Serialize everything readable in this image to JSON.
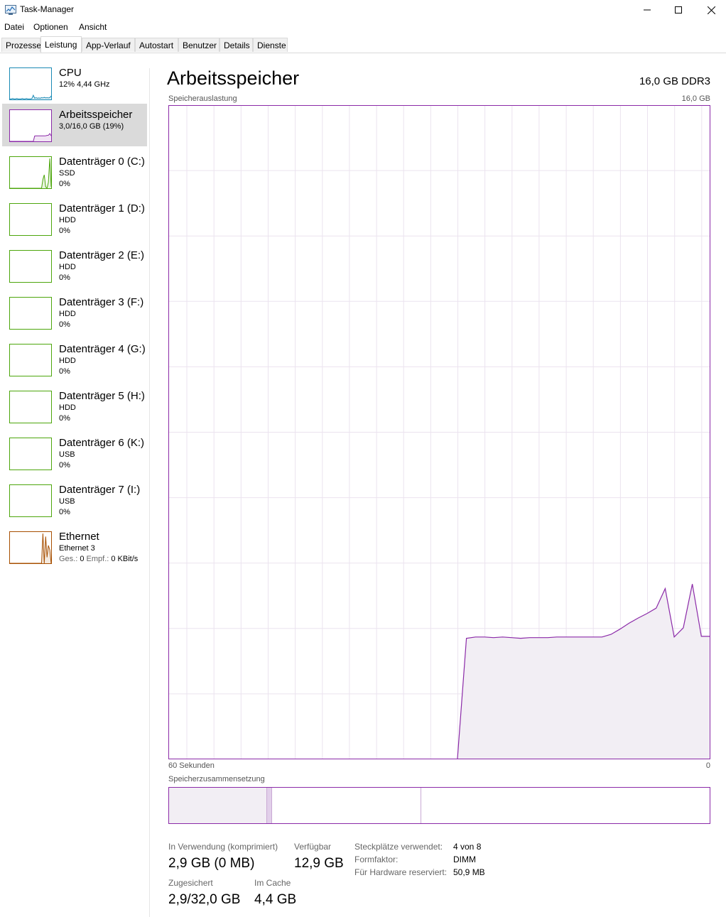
{
  "window": {
    "title": "Task-Manager",
    "icon": "task-manager-icon"
  },
  "menu": [
    "Datei",
    "Optionen",
    "Ansicht"
  ],
  "tabs": [
    "Prozesse",
    "Leistung",
    "App-Verlauf",
    "Autostart",
    "Benutzer",
    "Details",
    "Dienste"
  ],
  "active_tab": "Leistung",
  "sidebar": [
    {
      "title": "CPU",
      "line2": "12%  4,44 GHz",
      "line3": "",
      "color": "#1a8ab5",
      "values": [
        2,
        2,
        3,
        2,
        2,
        3,
        2,
        2,
        2,
        3,
        2,
        2,
        3,
        2,
        2,
        2,
        3,
        14,
        4,
        6,
        4,
        5,
        4,
        6,
        5,
        7,
        5,
        6,
        5,
        6,
        12
      ]
    },
    {
      "title": "Arbeitsspeicher",
      "line2": "3,0/16,0 GB (19%)",
      "line3": "",
      "color": "#8b2aa8",
      "selected": true,
      "values": [
        0,
        0,
        0,
        0,
        0,
        0,
        0,
        0,
        0,
        0,
        0,
        0,
        0,
        0,
        0,
        0,
        0,
        0,
        18,
        18.6,
        18.6,
        18.5,
        18.6,
        18.6,
        18.6,
        18.6,
        19,
        20,
        20.5,
        26,
        18.8
      ]
    },
    {
      "title": "Datenträger 0 (C:)",
      "line2": "SSD",
      "line3": "0%",
      "color": "#4da60c",
      "values": [
        0,
        0,
        0,
        0,
        0,
        0,
        0,
        0,
        0,
        0,
        0,
        0,
        0,
        0,
        0,
        0,
        0,
        0,
        0,
        0,
        0,
        0,
        0,
        0,
        30,
        45,
        5,
        0,
        20,
        100,
        5
      ]
    },
    {
      "title": "Datenträger 1 (D:)",
      "line2": "HDD",
      "line3": "0%",
      "color": "#4da60c",
      "values": []
    },
    {
      "title": "Datenträger 2 (E:)",
      "line2": "HDD",
      "line3": "0%",
      "color": "#4da60c",
      "values": []
    },
    {
      "title": "Datenträger 3 (F:)",
      "line2": "HDD",
      "line3": "0%",
      "color": "#4da60c",
      "values": []
    },
    {
      "title": "Datenträger 4 (G:)",
      "line2": "HDD",
      "line3": "0%",
      "color": "#4da60c",
      "values": []
    },
    {
      "title": "Datenträger 5 (H:)",
      "line2": "HDD",
      "line3": "0%",
      "color": "#4da60c",
      "values": []
    },
    {
      "title": "Datenträger 6 (K:)",
      "line2": "USB",
      "line3": "0%",
      "color": "#4da60c",
      "values": []
    },
    {
      "title": "Datenträger 7 (I:)",
      "line2": "USB",
      "line3": "0%",
      "color": "#4da60c",
      "values": []
    },
    {
      "title": "Ethernet",
      "line2": "Ethernet 3",
      "line3": "",
      "color": "#a74f01",
      "values": [
        0,
        0,
        0,
        0,
        0,
        0,
        0,
        0,
        0,
        0,
        0,
        0,
        0,
        0,
        0,
        0,
        0,
        0,
        0,
        0,
        0,
        0,
        0,
        0,
        100,
        0,
        90,
        20,
        60,
        45,
        0
      ]
    }
  ],
  "ethernet_rate": {
    "sent_label": "Ges.:",
    "sent": "0",
    "recv_label": "Empf.:",
    "recv": "0 KBit/s"
  },
  "main": {
    "title": "Arbeitsspeicher",
    "subtitle": "16,0 GB DDR3",
    "graph_label": "Speicherauslastung",
    "graph_max": "16,0 GB",
    "time_left": "60 Sekunden",
    "time_right": "0",
    "composition_label": "Speicherzusammensetzung"
  },
  "chart_data": {
    "type": "area",
    "color": "#8b2aa8",
    "ylim": [
      0,
      100
    ],
    "x": [
      0,
      1,
      2,
      3,
      4,
      5,
      6,
      7,
      8,
      9,
      10,
      11,
      12,
      13,
      14,
      15,
      16,
      17,
      18,
      19,
      20,
      21,
      22,
      23,
      24,
      25,
      26,
      27,
      28,
      29,
      30,
      31,
      32,
      33,
      34,
      35,
      36,
      37,
      38,
      39,
      40,
      41,
      42,
      43,
      44,
      45,
      46,
      47,
      48,
      49,
      50,
      51,
      52,
      53,
      54,
      55,
      56,
      57,
      58,
      59,
      60
    ],
    "values": [
      null,
      null,
      null,
      null,
      null,
      null,
      null,
      null,
      null,
      null,
      null,
      null,
      null,
      null,
      null,
      null,
      null,
      null,
      null,
      null,
      null,
      null,
      null,
      null,
      null,
      null,
      null,
      null,
      null,
      null,
      null,
      null,
      0,
      18.5,
      18.7,
      18.7,
      18.6,
      18.7,
      18.6,
      18.5,
      18.6,
      18.6,
      18.6,
      18.7,
      18.7,
      18.7,
      18.7,
      18.7,
      18.7,
      19.1,
      19.9,
      20.8,
      21.6,
      22.3,
      23.1,
      26.1,
      18.7,
      20.1,
      26.8,
      18.8,
      18.8
    ]
  },
  "composition": {
    "in_use": 0.18,
    "modified": 0.008,
    "standby": 0.272,
    "free": 0.54
  },
  "stats": [
    {
      "label": "In Verwendung (komprimiert)",
      "value": "2,9 GB (0 MB)"
    },
    {
      "label": "Verfügbar",
      "value": "12,9 GB"
    },
    {
      "label": "Zugesichert",
      "value": "2,9/32,0 GB"
    },
    {
      "label": "Im Cache",
      "value": "4,4 GB"
    }
  ],
  "details": [
    {
      "label": "Steckplätze verwendet:",
      "value": "4 von 8"
    },
    {
      "label": "Formfaktor:",
      "value": "DIMM"
    },
    {
      "label": "Für Hardware reserviert:",
      "value": "50,9 MB"
    }
  ]
}
